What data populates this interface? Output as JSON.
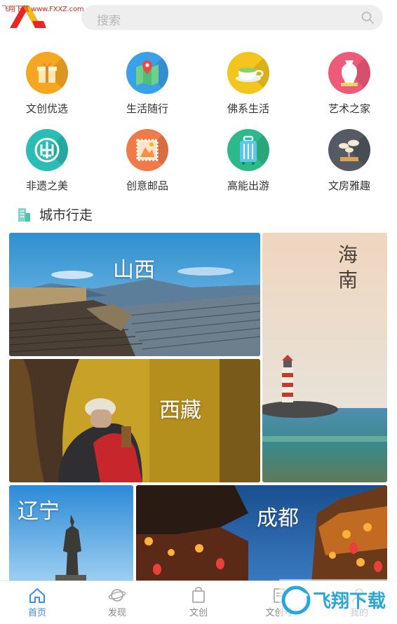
{
  "header": {
    "watermark": "飞翔下载 www.FXXZ.com",
    "search_placeholder": "搜索"
  },
  "categories": [
    {
      "label": "文创优选",
      "icon": "gift-icon",
      "color": "#f5a623"
    },
    {
      "label": "生活随行",
      "icon": "map-pin-icon",
      "color": "#3aa0e8"
    },
    {
      "label": "佛系生活",
      "icon": "tea-cup-icon",
      "color": "#f3c51e"
    },
    {
      "label": "艺术之家",
      "icon": "vase-icon",
      "color": "#ee5a7a"
    },
    {
      "label": "非遗之美",
      "icon": "paper-cut-icon",
      "color": "#2bbcb5"
    },
    {
      "label": "创意邮品",
      "icon": "stamp-icon",
      "color": "#f07a4a"
    },
    {
      "label": "高能出游",
      "icon": "suitcase-icon",
      "color": "#2fb98a"
    },
    {
      "label": "文房雅趣",
      "icon": "bonsai-icon",
      "color": "#555a63"
    }
  ],
  "section": {
    "title": "城市行走"
  },
  "cities": [
    {
      "name": "山西"
    },
    {
      "name": "海南"
    },
    {
      "name": "西藏"
    },
    {
      "name": "辽宁"
    },
    {
      "name": "成都"
    }
  ],
  "nav": [
    {
      "label": "首页",
      "icon": "home-icon",
      "active": true
    },
    {
      "label": "发现",
      "icon": "planet-icon",
      "active": false
    },
    {
      "label": "文创",
      "icon": "bag-icon",
      "active": false
    },
    {
      "label": "文创号",
      "icon": "document-icon",
      "active": false
    },
    {
      "label": "我的",
      "icon": "user-icon",
      "active": false
    }
  ],
  "watermark_bottom": "飞翔下载",
  "colors": {
    "accent": "#3a8ee6"
  }
}
